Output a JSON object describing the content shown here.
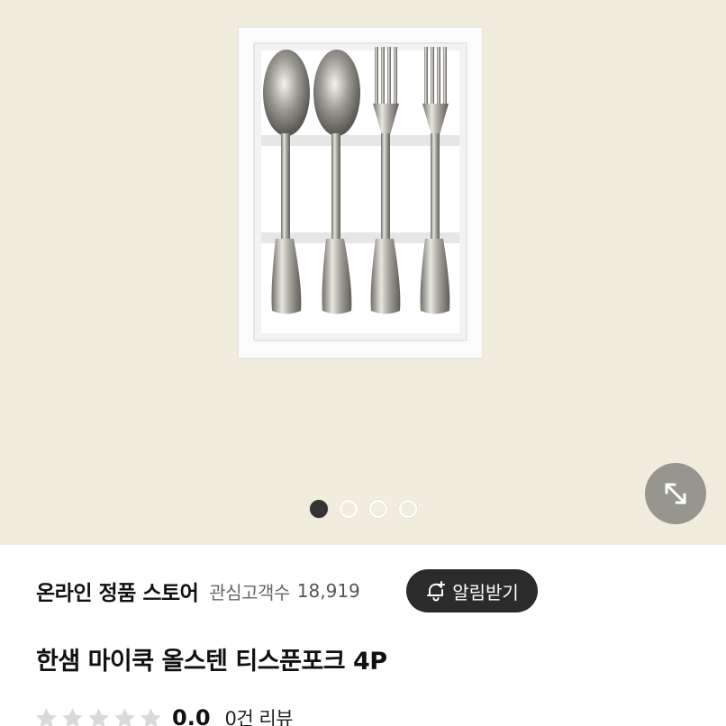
{
  "gallery": {
    "dot_count": 4,
    "active_index": 0,
    "expand_icon": "expand-arrows-icon"
  },
  "store": {
    "name": "온라인 정품 스토어",
    "followers_label": "관심고객수",
    "followers_count": "18,919",
    "notify_label": "알림받기",
    "notify_icon": "bell-plus-icon"
  },
  "product": {
    "title": "한샘 마이쿡 올스텐 티스푼포크 4P"
  },
  "rating": {
    "score": "0.0",
    "stars_filled": 0,
    "stars_total": 5,
    "review_text": "0건 리뷰"
  },
  "colors": {
    "hero_bg": "#f1edde",
    "button_dark": "#2b2b2b",
    "star_empty": "#d9d9d9"
  }
}
